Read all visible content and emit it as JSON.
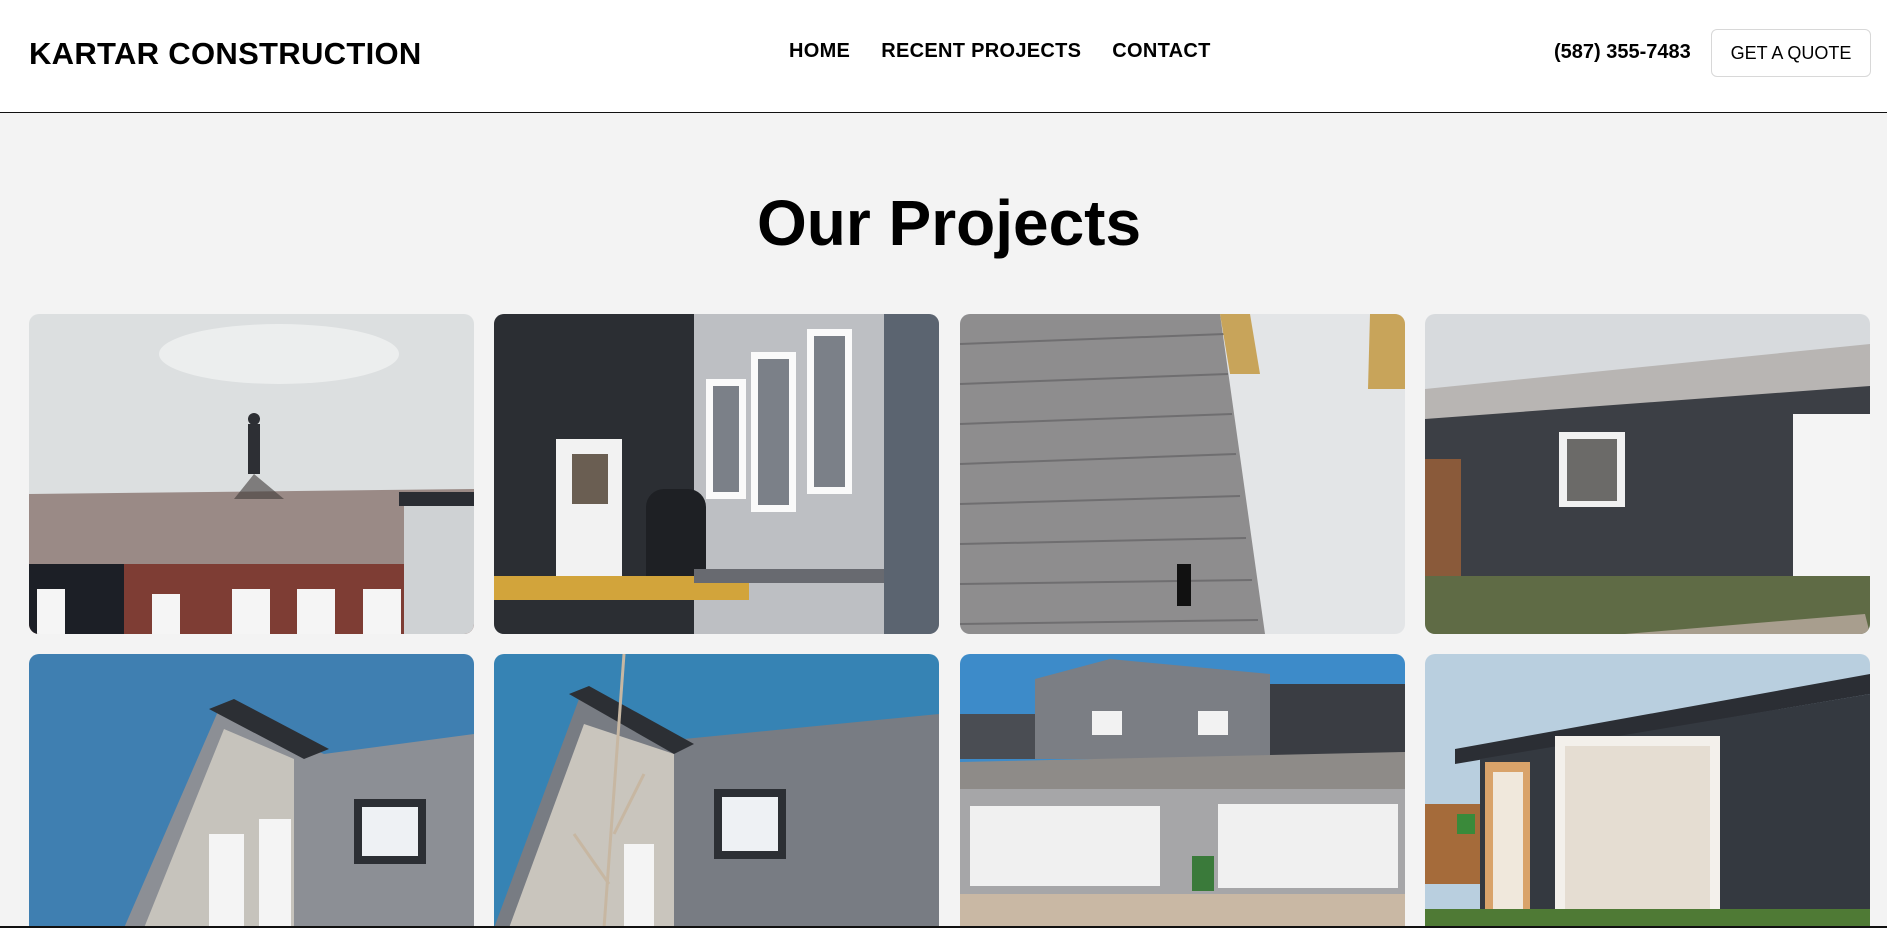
{
  "header": {
    "brand": "KARTAR CONSTRUCTION",
    "nav": [
      {
        "label": "HOME"
      },
      {
        "label": "RECENT PROJECTS"
      },
      {
        "label": "CONTACT"
      }
    ],
    "phone": "(587) 355-7483",
    "quote_button": "GET A QUOTE"
  },
  "main": {
    "title": "Our Projects",
    "projects": [
      {
        "icon": "photo-roofer-on-roof"
      },
      {
        "icon": "photo-house-balcony-siding"
      },
      {
        "icon": "photo-grey-siding-closeup"
      },
      {
        "icon": "photo-dark-garage-side"
      },
      {
        "icon": "photo-gable-roof-blue-sky"
      },
      {
        "icon": "photo-gable-roof-tree"
      },
      {
        "icon": "photo-double-garage-lane"
      },
      {
        "icon": "photo-garage-white-door"
      }
    ]
  },
  "colors": {
    "page_background": "#f3f3f3",
    "header_background": "#ffffff",
    "text": "#000000"
  }
}
